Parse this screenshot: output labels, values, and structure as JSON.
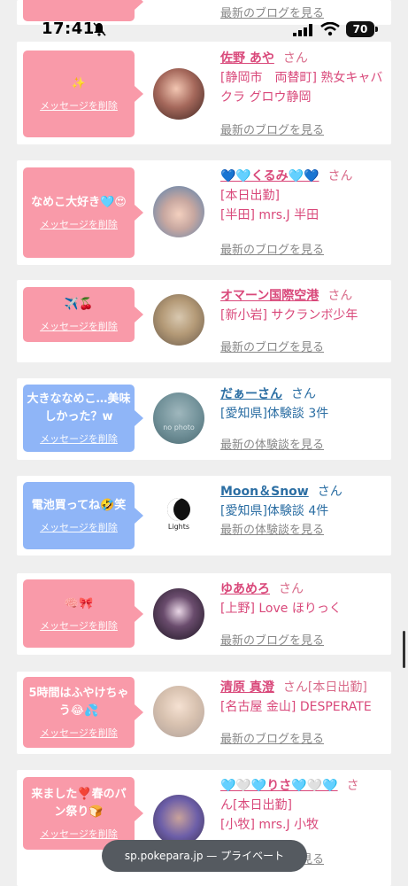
{
  "status_bar": {
    "time": "17:41",
    "battery": "70"
  },
  "top_partial": {
    "blog_link": "最新のブログを見る"
  },
  "cards": [
    {
      "bubble_text": "✨",
      "delete_label": "メッセージを削除",
      "name": "佐野 あや",
      "suffix": "さん",
      "shop": "[静岡市　両替町] 熟女キャバクラ グロウ静岡",
      "blog_link": "最新のブログを見る"
    },
    {
      "bubble_text": "なめこ大好き🩵😍",
      "delete_label": "メッセージを削除",
      "name": "💙🩵くるみ🩵💙",
      "suffix": "さん",
      "shop": "[本日出勤]",
      "shop2": "[半田] mrs.J 半田",
      "blog_link": "最新のブログを見る"
    },
    {
      "bubble_text": "✈️🍒",
      "delete_label": "メッセージを削除",
      "name": "オマーン国際空港",
      "suffix": "さん",
      "shop": "[新小岩] サクランボ少年",
      "blog_link": "最新のブログを見る"
    },
    {
      "bubble_text": "大きななめこ…美味しかった？w",
      "delete_label": "メッセージを削除",
      "name": "だぁーさん",
      "suffix": "さん",
      "shop": "[愛知県]体験談 3件",
      "blog_link": "最新の体験談を見る",
      "avatar_text": "no photo"
    },
    {
      "bubble_text": "電池買ってね🤣笑",
      "delete_label": "メッセージを削除",
      "name": "Moon＆Snow",
      "suffix": "さん",
      "shop": "[愛知県]体験談 4件",
      "blog_link": "最新の体験談を見る",
      "avatar_text": "Lights"
    },
    {
      "bubble_text": "🧠🎀",
      "delete_label": "メッセージを削除",
      "name": "ゆあめろ",
      "suffix": "さん",
      "shop": "[上野] Love ほりっく",
      "blog_link": "最新のブログを見る"
    },
    {
      "bubble_text": "5時間はふやけちゃう😂💦",
      "delete_label": "メッセージを削除",
      "name": "清原 真澄",
      "suffix": "さん[本日出勤]",
      "shop": "[名古屋 金山] DESPERATE",
      "blog_link": "最新のブログを見る"
    },
    {
      "bubble_text": "来ました❣️春のパン祭り🍞",
      "delete_label": "メッセージを削除",
      "name": "🩵🤍🩵りさ🩵🤍🩵",
      "suffix": "さ",
      "suffix2": "ん[本日出勤]",
      "shop": "[小牧] mrs.J 小牧",
      "blog_link": "最新のブログを見る"
    }
  ],
  "url_bar": {
    "text": "sp.pokepara.jp — プライベート"
  }
}
